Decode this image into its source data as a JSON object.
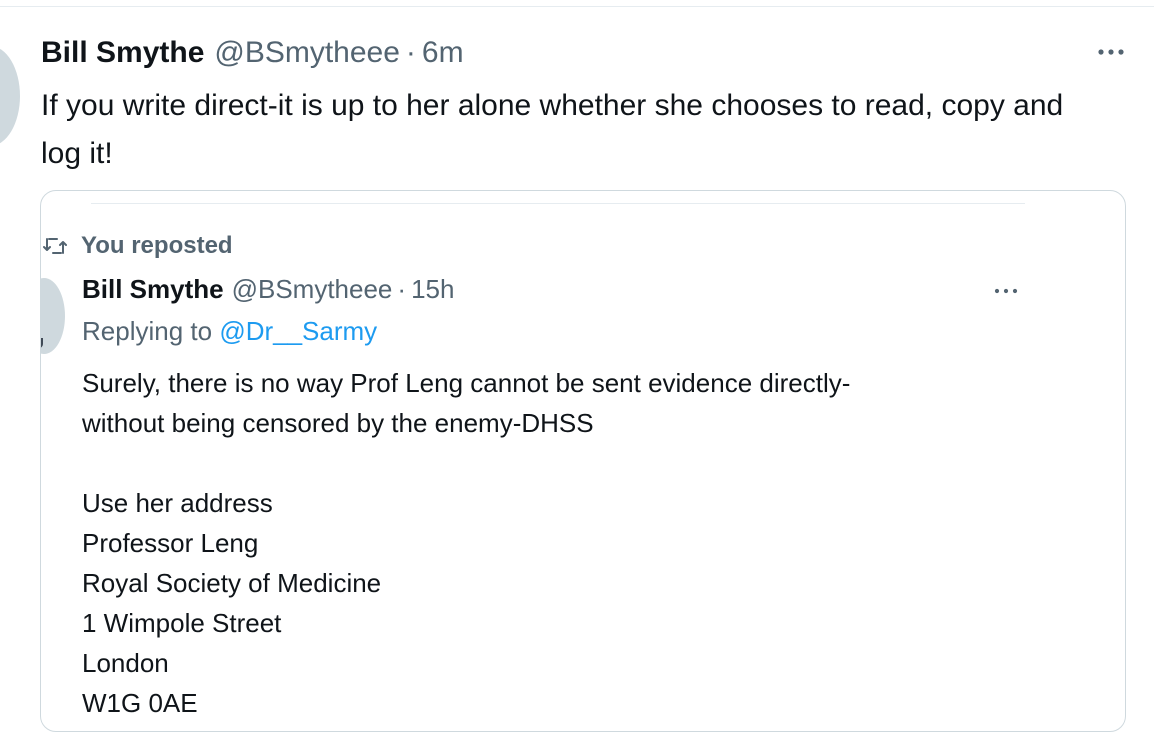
{
  "tweet": {
    "display_name": "Bill Smythe",
    "handle": "@BSmytheee",
    "separator": "·",
    "time": "6m",
    "text": "If you write direct-it is up to her alone whether she chooses to read, copy and log it!",
    "more_icon": "ellipsis-icon"
  },
  "quoted_tweet": {
    "social_context": {
      "icon": "repost-icon",
      "label": "You reposted"
    },
    "display_name": "Bill Smythe",
    "handle": "@BSmytheee",
    "separator": "·",
    "time": "15h",
    "more_icon": "ellipsis-icon",
    "reply_prefix": "Replying to",
    "reply_to": "@Dr__Sarmy",
    "body": {
      "paragraph1_line1": "Surely, there is no way Prof Leng cannot be sent evidence directly-",
      "paragraph1_line2": "without being censored by the enemy-DHSS",
      "address_intro": "Use her address",
      "address_name": "Professor Leng",
      "address_org": "Royal Society of Medicine",
      "address_street": "1 Wimpole Street",
      "address_city": "London",
      "address_postcode": "W1G 0AE"
    }
  },
  "colors": {
    "text_primary": "#0f1419",
    "text_secondary": "#536471",
    "link": "#1d9bf0",
    "border": "#cfd9de",
    "avatar_placeholder": "#cfd9de"
  }
}
